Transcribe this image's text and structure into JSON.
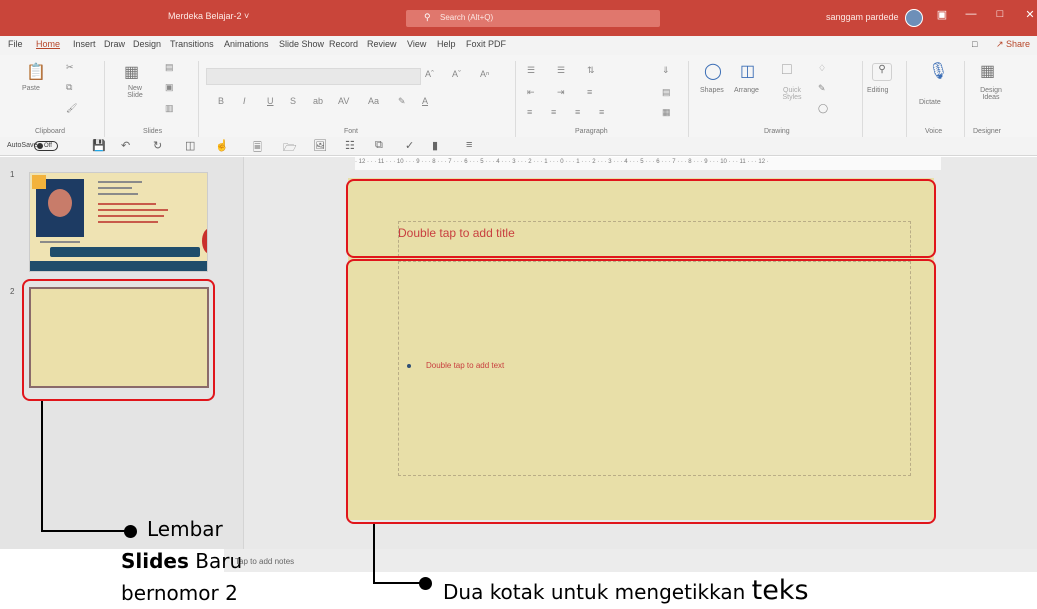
{
  "titlebar": {
    "doc_title": "Merdeka Belajar-2  ˅",
    "search_placeholder": "Search (Alt+Q)",
    "user": "sanggam pardede",
    "min": "—",
    "max": "□",
    "close": "✕"
  },
  "menu": [
    "File",
    "Home",
    "Insert",
    "Draw",
    "Design",
    "Transitions",
    "Animations",
    "Slide Show",
    "Record",
    "Review",
    "View",
    "Help",
    "Foxit PDF"
  ],
  "share_label": "Share",
  "ribbon": {
    "paste": "Paste",
    "new_slide": "New Slide",
    "clipboard": "Clipboard",
    "slides": "Slides",
    "font": "Font",
    "paragraph": "Paragraph",
    "shapes": "Shapes",
    "arrange": "Arrange",
    "quick_styles": "Quick Styles",
    "drawing": "Drawing",
    "editing": "Editing",
    "dictate": "Dictate",
    "voice": "Voice",
    "design_ideas": "Design Ideas",
    "designer": "Designer"
  },
  "qat": {
    "autosave": "AutoSave",
    "toggle": "Off"
  },
  "hruler": "· 12 · · · 11 · · · 10 · · · 9 · · · 8 · · · 7 · · · 6 · · · 5 · · · 4 · · · 3 · · · 2 · · · 1 · · · 0 · · · 1 · · · 2 · · · 3 · · · 4 · · · 5 · · · 6 · · · 7 · · · 8 · · · 9 · · · 10 · · · 11 · · · 12 ·",
  "thumbnails": [
    {
      "number": "1"
    },
    {
      "number": "2"
    }
  ],
  "slide": {
    "title_placeholder": "Double tap to add title",
    "body_placeholder": "Double tap to add text"
  },
  "notes_placeholder": "Tap to add notes",
  "annotations": {
    "left_line1": "Lembar",
    "left_bold": "Slides",
    "left_line2_rest": " Baru",
    "left_line3": "bernomor 2",
    "right_prefix": "Dua kotak untuk mengetikkan ",
    "right_big": "teks"
  },
  "colors": {
    "accent": "#c9453a",
    "slide_bg": "#e8dfa8",
    "annotation_red": "#e0151b"
  }
}
